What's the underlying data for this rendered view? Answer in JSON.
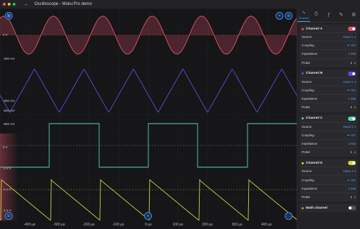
{
  "window": {
    "title": "Oscilloscope - Moku:Pro demo",
    "back_icon": "arrow-left-icon"
  },
  "plot": {
    "y_labels": {
      "a_top": "0 V",
      "a_bottom": "-300 mV",
      "b_top": "-300 mV",
      "b_bottom": "-600 mV",
      "c_top": "-800 mV",
      "c_mid": "0 V",
      "c_bottom": "-1.2 V",
      "d_top": "-1.4 V",
      "d_bottom": "-1.4 V"
    },
    "x_ticks": [
      "-400 µs",
      "-300 µs",
      "-200 µs",
      "-100 µs",
      "0 µs",
      "100 µs",
      "200 µs",
      "300 µs",
      "400 µs"
    ]
  },
  "colors": {
    "channel_a": "#e8546a",
    "channel_b": "#5552d8",
    "channel_c": "#5fd1b8",
    "channel_d": "#cfd44a",
    "math": "#e0853a",
    "accent": "#4aa0ff"
  },
  "sidebar": {
    "tabs": [
      {
        "icon": "waveform-icon",
        "label": "Channel"
      },
      {
        "icon": "timer-icon",
        "label": ""
      },
      {
        "icon": "function-icon",
        "label": ""
      },
      {
        "icon": "probe-icon",
        "label": ""
      },
      {
        "icon": "settings-icon",
        "label": ""
      }
    ],
    "channels": [
      {
        "name": "Channel A",
        "source": "Input 1",
        "coupling": "DC",
        "impedance": "1 MΩ",
        "probe": "1",
        "enabled": true
      },
      {
        "name": "Channel B",
        "source": "Input 2",
        "coupling": "DC",
        "impedance": "1 MΩ",
        "probe": "1",
        "enabled": true
      },
      {
        "name": "Channel C",
        "source": "Input 3",
        "coupling": "DC",
        "impedance": "1 MΩ",
        "probe": "1",
        "enabled": true
      },
      {
        "name": "Channel D",
        "source": "Input 4",
        "coupling": "DC",
        "impedance": "1 MΩ",
        "probe": "1",
        "enabled": true
      }
    ],
    "row_labels": {
      "source": "Source",
      "coupling": "Coupling",
      "impedance": "Impedance",
      "probe": "Probe"
    },
    "probe_suffix": "x",
    "math_channel": {
      "name": "Math channel",
      "enabled": false
    }
  }
}
